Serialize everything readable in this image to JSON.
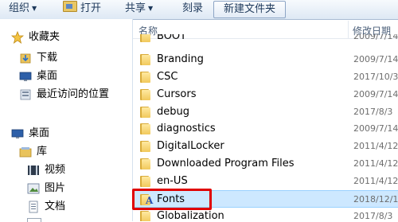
{
  "toolbar": {
    "organize": "组织",
    "open": "打开",
    "share": "共享",
    "burn": "刻录",
    "new_folder": "新建文件夹"
  },
  "sidebar": {
    "favorites": "收藏夹",
    "downloads": "下载",
    "desktop_fav": "桌面",
    "recent": "最近访问的位置",
    "desktop": "桌面",
    "libraries": "库",
    "videos": "视频",
    "pictures": "图片",
    "documents": "文档"
  },
  "columns": {
    "name": "名称",
    "date_modified": "修改日期"
  },
  "rows": [
    {
      "name": "BOOT",
      "date": "2009/7/14"
    },
    {
      "name": "Branding",
      "date": "2009/7/14"
    },
    {
      "name": "CSC",
      "date": "2017/10/3"
    },
    {
      "name": "Cursors",
      "date": "2009/7/14"
    },
    {
      "name": "debug",
      "date": "2017/8/3"
    },
    {
      "name": "diagnostics",
      "date": "2009/7/14"
    },
    {
      "name": "DigitalLocker",
      "date": "2011/4/12"
    },
    {
      "name": "Downloaded Program Files",
      "date": "2011/4/12"
    },
    {
      "name": "en-US",
      "date": "2011/4/12"
    },
    {
      "name": "Fonts",
      "date": "2018/12/1",
      "selected": true
    },
    {
      "name": "Globalization",
      "date": "2017/8/3"
    }
  ]
}
